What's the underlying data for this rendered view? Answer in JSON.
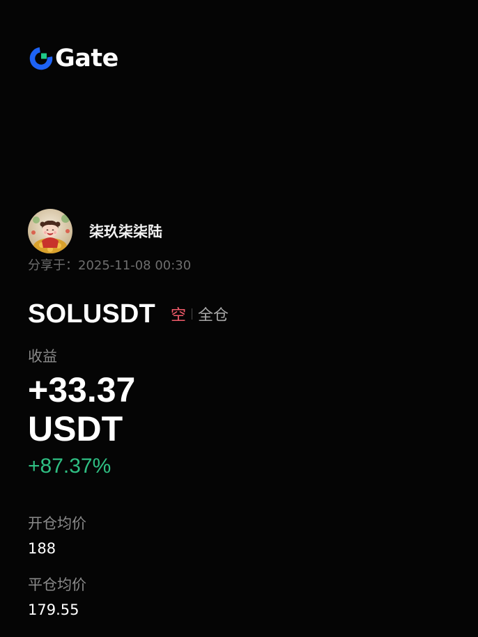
{
  "brand": {
    "name": "Gate",
    "logo_icon": "gate-logo-icon",
    "accent_color": "#1e63f5"
  },
  "user": {
    "name": "柒玖柒柒陆",
    "avatar_icon": "user-avatar"
  },
  "share": {
    "text": "分享于：2025-11-08 00:30"
  },
  "position": {
    "symbol": "SOLUSDT",
    "side": "空",
    "side_color": "#f25c6b",
    "margin_mode": "全仓"
  },
  "pnl": {
    "label": "收益",
    "value": "+33.37",
    "unit": "USDT",
    "percent": "+87.37%",
    "percent_color": "#2fbf83"
  },
  "prices": {
    "entry_label": "开仓均价",
    "entry_value": "188",
    "exit_label": "平仓均价",
    "exit_value": "179.55"
  }
}
